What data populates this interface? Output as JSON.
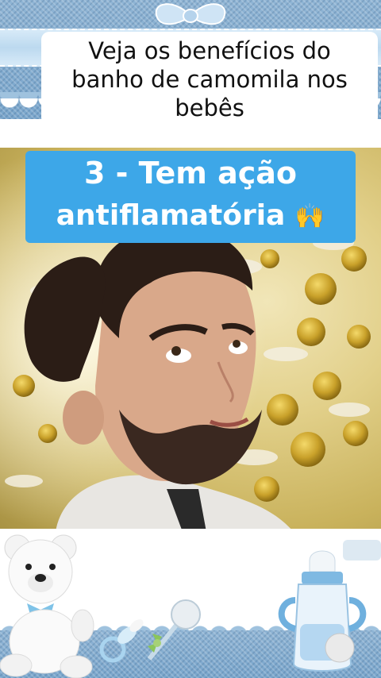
{
  "title": {
    "lines": [
      "Veja os benefícios do",
      "banho de camomila nos",
      "bebês"
    ]
  },
  "headline": {
    "line1": "3 - Tem ação",
    "line2": "antiflamatória",
    "emoji": "🙌",
    "background": "#3da7e8",
    "text_color": "#ffffff"
  },
  "decor": {
    "theme_color": "#8fb4d4",
    "icons": [
      "bow-icon",
      "teddy-bear-icon",
      "pacifier-icon",
      "rattle-icon",
      "baby-bottle-icon",
      "chamomile-flowers"
    ]
  }
}
